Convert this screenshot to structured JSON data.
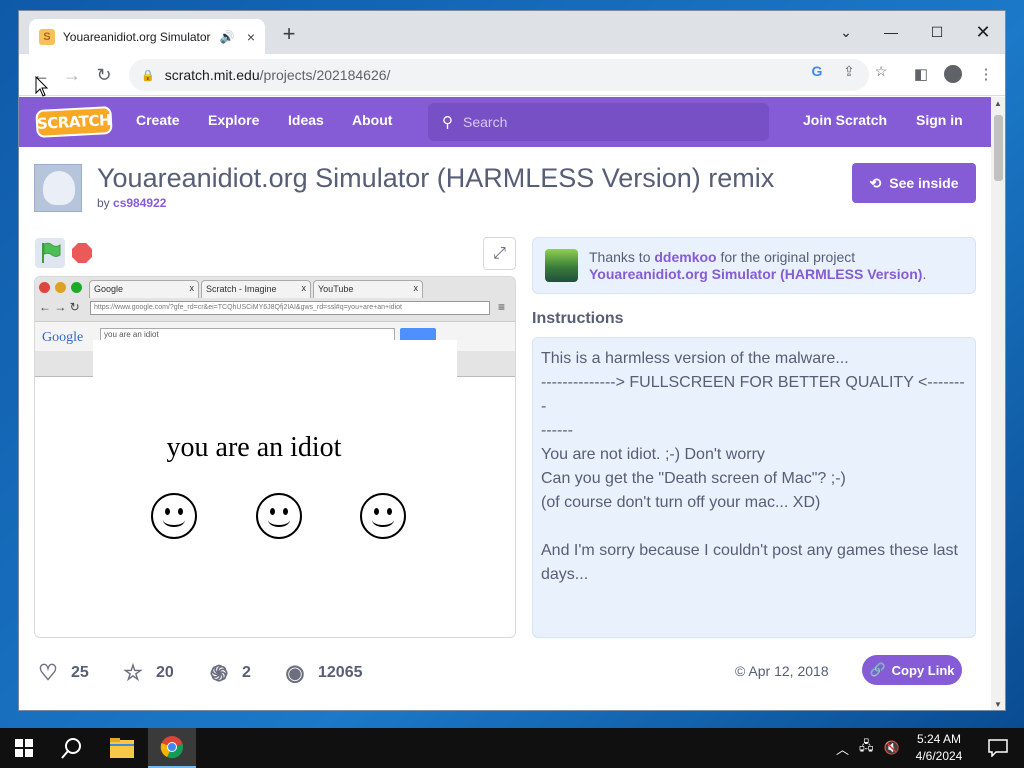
{
  "browser": {
    "tab_title": "Youareanidiot.org Simulator",
    "speaker_icon": "speaker-icon",
    "tab_close": "×",
    "new_tab": "+",
    "url_host": "scratch.mit.edu",
    "url_path": "/projects/202184626/"
  },
  "scratch_nav": {
    "logo": "SCRATCH",
    "create": "Create",
    "explore": "Explore",
    "ideas": "Ideas",
    "about": "About",
    "search_placeholder": "Search",
    "join": "Join Scratch",
    "signin": "Sign in",
    "accent": "#855cd6"
  },
  "project": {
    "title": "Youareanidiot.org Simulator (HARMLESS Version) remix",
    "by": "by",
    "author": "cs984922",
    "see_inside": "See inside"
  },
  "stage": {
    "tab1": "Google",
    "tab2": "Scratch - Imagine",
    "tab3": "YouTube",
    "tab_x": "x",
    "url": "https://www.google.com/?gfe_rd=cr&ei=TCQhUSCiMY6J8Qfj2IAI&gws_rd=ssl#q=you+are+an+idiot",
    "google": "Google",
    "query": "you are an idiot",
    "big_text": "you are an idiot"
  },
  "remix": {
    "thanks": "Thanks to",
    "orig_author": "ddemkoo",
    "for_text": "for the original project",
    "orig_title": "Youareanidiot.org Simulator (HARMLESS Version)",
    "period": "."
  },
  "instructions": {
    "label": "Instructions",
    "lines": [
      "This is a harmless version of the malware...",
      "--------------> FULLSCREEN FOR BETTER QUALITY <--------",
      "------",
      "You are not idiot. ;-) Don't worry",
      "Can you get the \"Death screen of Mac\"? ;-)",
      "(of course don't turn off your mac... XD)",
      "",
      "And I'm sorry because I couldn't post any games these last",
      "days..."
    ]
  },
  "stats": {
    "loves": "25",
    "favorites": "20",
    "remixes": "2",
    "views": "12065",
    "date": "© Apr 12, 2018",
    "copy_link": "Copy Link"
  },
  "taskbar": {
    "time": "5:24 AM",
    "date": "4/6/2024"
  }
}
